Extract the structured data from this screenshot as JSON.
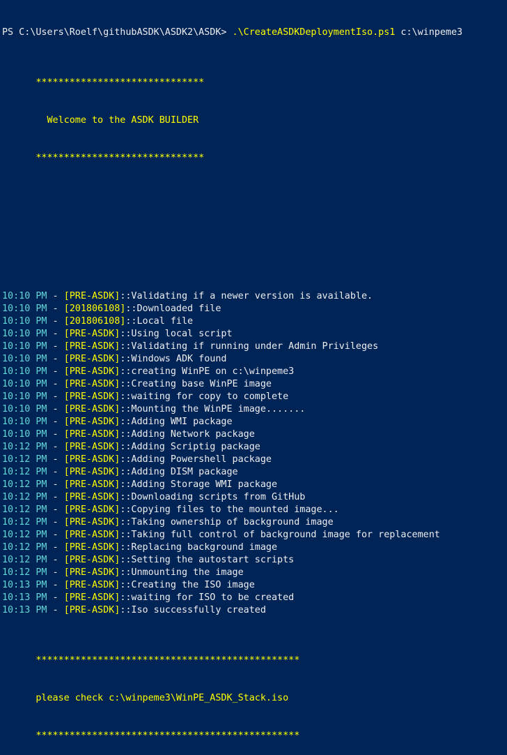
{
  "window": {
    "background": "#012456",
    "colors": {
      "default": "#eeedf0",
      "yellow": "#ffff00",
      "cyan": "#61d6d6"
    }
  },
  "prompt": {
    "text": "PS C:\\Users\\Roelf\\githubASDK\\ASDK2\\ASDK> ",
    "command": ".\\CreateASDKDeploymentIso.ps1",
    "argument": " c:\\winpeme3"
  },
  "banner": [
    "      ******************************",
    "        Welcome to the ASDK BUILDER",
    "      ******************************"
  ],
  "log": [
    {
      "time": "10:10 PM",
      "tag": "[PRE-ASDK]",
      "msg": "::Validating if a newer version is available."
    },
    {
      "time": "10:10 PM",
      "tag": "[201806108]",
      "msg": "::Downloaded file"
    },
    {
      "time": "10:10 PM",
      "tag": "[201806108]",
      "msg": "::Local file"
    },
    {
      "time": "10:10 PM",
      "tag": "[PRE-ASDK]",
      "msg": "::Using local script"
    },
    {
      "time": "10:10 PM",
      "tag": "[PRE-ASDK]",
      "msg": "::Validating if running under Admin Privileges"
    },
    {
      "time": "10:10 PM",
      "tag": "[PRE-ASDK]",
      "msg": "::Windows ADK found"
    },
    {
      "time": "10:10 PM",
      "tag": "[PRE-ASDK]",
      "msg": "::creating WinPE on c:\\winpeme3"
    },
    {
      "time": "10:10 PM",
      "tag": "[PRE-ASDK]",
      "msg": "::Creating base WinPE image"
    },
    {
      "time": "10:10 PM",
      "tag": "[PRE-ASDK]",
      "msg": "::waiting for copy to complete"
    },
    {
      "time": "10:10 PM",
      "tag": "[PRE-ASDK]",
      "msg": "::Mounting the WinPE image......."
    },
    {
      "time": "10:10 PM",
      "tag": "[PRE-ASDK]",
      "msg": "::Adding WMI package"
    },
    {
      "time": "10:10 PM",
      "tag": "[PRE-ASDK]",
      "msg": "::Adding Network package"
    },
    {
      "time": "10:12 PM",
      "tag": "[PRE-ASDK]",
      "msg": "::Adding Scriptig package"
    },
    {
      "time": "10:12 PM",
      "tag": "[PRE-ASDK]",
      "msg": "::Adding Powershell package"
    },
    {
      "time": "10:12 PM",
      "tag": "[PRE-ASDK]",
      "msg": "::Adding DISM package"
    },
    {
      "time": "10:12 PM",
      "tag": "[PRE-ASDK]",
      "msg": "::Adding Storage WMI package"
    },
    {
      "time": "10:12 PM",
      "tag": "[PRE-ASDK]",
      "msg": "::Downloading scripts from GitHub"
    },
    {
      "time": "10:12 PM",
      "tag": "[PRE-ASDK]",
      "msg": "::Copying files to the mounted image..."
    },
    {
      "time": "10:12 PM",
      "tag": "[PRE-ASDK]",
      "msg": "::Taking ownership of background image"
    },
    {
      "time": "10:12 PM",
      "tag": "[PRE-ASDK]",
      "msg": "::Taking full control of background image for replacement"
    },
    {
      "time": "10:12 PM",
      "tag": "[PRE-ASDK]",
      "msg": "::Replacing background image"
    },
    {
      "time": "10:12 PM",
      "tag": "[PRE-ASDK]",
      "msg": "::Setting the autostart scripts"
    },
    {
      "time": "10:12 PM",
      "tag": "[PRE-ASDK]",
      "msg": "::Unmounting the image"
    },
    {
      "time": "10:13 PM",
      "tag": "[PRE-ASDK]",
      "msg": "::Creating the ISO image"
    },
    {
      "time": "10:13 PM",
      "tag": "[PRE-ASDK]",
      "msg": "::waiting for ISO to be created"
    },
    {
      "time": "10:13 PM",
      "tag": "[PRE-ASDK]",
      "msg": "::Iso successfully created"
    }
  ],
  "log_separator": " - ",
  "footer": [
    "      ***********************************************",
    "      please check c:\\winpeme3\\WinPE_ASDK_Stack.iso",
    "      ***********************************************"
  ]
}
